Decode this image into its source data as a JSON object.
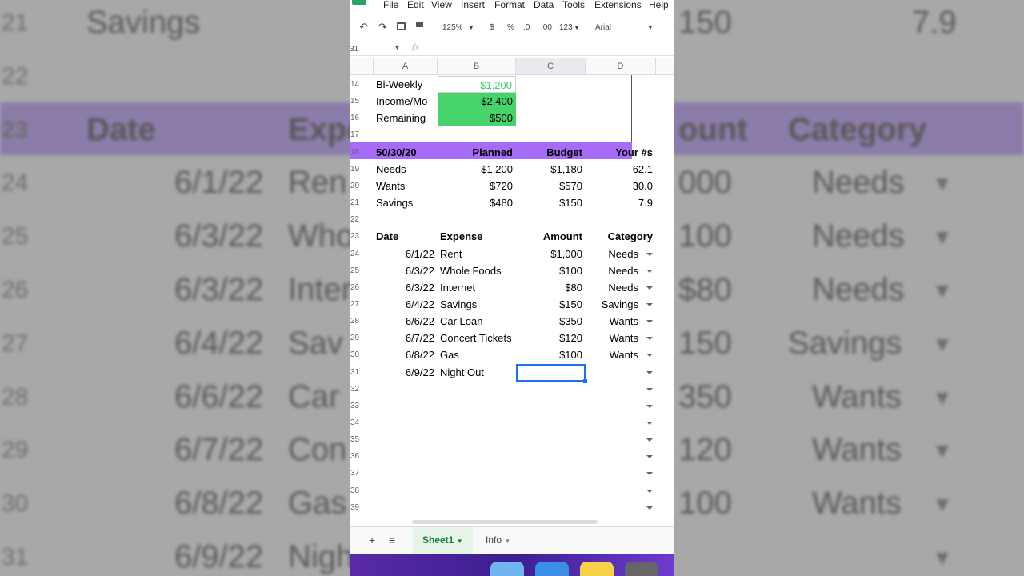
{
  "menu": [
    "File",
    "Edit",
    "View",
    "Insert",
    "Format",
    "Data",
    "Tools",
    "Extensions",
    "Help"
  ],
  "toolbar": {
    "zoom": "125%",
    "currency": "$",
    "percent": "%",
    "dec_less": ".0",
    "dec_more": ".00",
    "format": "123",
    "font": "Arial"
  },
  "formula_bar": {
    "name_box": "31",
    "fx": "fx"
  },
  "columns": [
    "A",
    "B",
    "C",
    "D"
  ],
  "income": [
    {
      "row": "14",
      "label": "Bi-Weekly",
      "value": "$1,200"
    },
    {
      "row": "15",
      "label": "Income/Mo",
      "value": "$2,400"
    },
    {
      "row": "16",
      "label": "Remaining",
      "value": "$500"
    }
  ],
  "row17": "17",
  "budget_header": {
    "row": "18",
    "a": "50/30/20",
    "b": "Planned",
    "c": "Budget",
    "d": "Your #s"
  },
  "budget_rows": [
    {
      "row": "19",
      "a": "Needs",
      "b": "$1,200",
      "c": "$1,180",
      "d": "62.1"
    },
    {
      "row": "20",
      "a": "Wants",
      "b": "$720",
      "c": "$570",
      "d": "30.0"
    },
    {
      "row": "21",
      "a": "Savings",
      "b": "$480",
      "c": "$150",
      "d": "7.9"
    }
  ],
  "row22": "22",
  "expense_header": {
    "row": "23",
    "a": "Date",
    "b": "Expense",
    "c": "Amount",
    "d": "Category"
  },
  "expenses": [
    {
      "row": "24",
      "date": "6/1/22",
      "expense": "Rent",
      "amount": "$1,000",
      "category": "Needs"
    },
    {
      "row": "25",
      "date": "6/3/22",
      "expense": "Whole Foods",
      "amount": "$100",
      "category": "Needs"
    },
    {
      "row": "26",
      "date": "6/3/22",
      "expense": "Internet",
      "amount": "$80",
      "category": "Needs"
    },
    {
      "row": "27",
      "date": "6/4/22",
      "expense": "Savings",
      "amount": "$150",
      "category": "Savings"
    },
    {
      "row": "28",
      "date": "6/6/22",
      "expense": "Car Loan",
      "amount": "$350",
      "category": "Wants"
    },
    {
      "row": "29",
      "date": "6/7/22",
      "expense": "Concert Tickets",
      "amount": "$120",
      "category": "Wants"
    },
    {
      "row": "30",
      "date": "6/8/22",
      "expense": "Gas",
      "amount": "$100",
      "category": "Wants"
    },
    {
      "row": "31",
      "date": "6/9/22",
      "expense": "Night Out",
      "amount": "",
      "category": ""
    }
  ],
  "empty_rows": [
    "32",
    "33",
    "34",
    "35",
    "36",
    "37",
    "38",
    "39"
  ],
  "sheets": {
    "add": "+",
    "list": "≡",
    "sheet1": "Sheet1",
    "info": "Info"
  },
  "background": {
    "rows": [
      {
        "num": "21",
        "a": "Savings",
        "c": "150",
        "d": "7.9"
      },
      {
        "num": "22",
        "a": "",
        "c": "",
        "d": ""
      },
      {
        "num": "23",
        "a": "Date",
        "b": "Expe",
        "c": "ount",
        "d": "Category"
      },
      {
        "num": "24",
        "date": "6/1/22",
        "b": "Ren",
        "c": "000",
        "d": "Needs"
      },
      {
        "num": "25",
        "date": "6/3/22",
        "b": "Who",
        "c": "100",
        "d": "Needs"
      },
      {
        "num": "26",
        "date": "6/3/22",
        "b": "Inter",
        "c": "$80",
        "d": "Needs"
      },
      {
        "num": "27",
        "date": "6/4/22",
        "b": "Sav",
        "c": "150",
        "d": "Savings"
      },
      {
        "num": "28",
        "date": "6/6/22",
        "b": "Car",
        "c": "350",
        "d": "Wants"
      },
      {
        "num": "29",
        "date": "6/7/22",
        "b": "Con",
        "c": "120",
        "d": "Wants"
      },
      {
        "num": "30",
        "date": "6/8/22",
        "b": "Gas",
        "c": "100",
        "d": "Wants"
      },
      {
        "num": "31",
        "date": "6/9/22",
        "b": "Nigh",
        "c": "",
        "d": ""
      }
    ]
  },
  "colors": {
    "green": "#45d36a",
    "purple": "#a66cf8",
    "selection": "#1a73e8"
  }
}
